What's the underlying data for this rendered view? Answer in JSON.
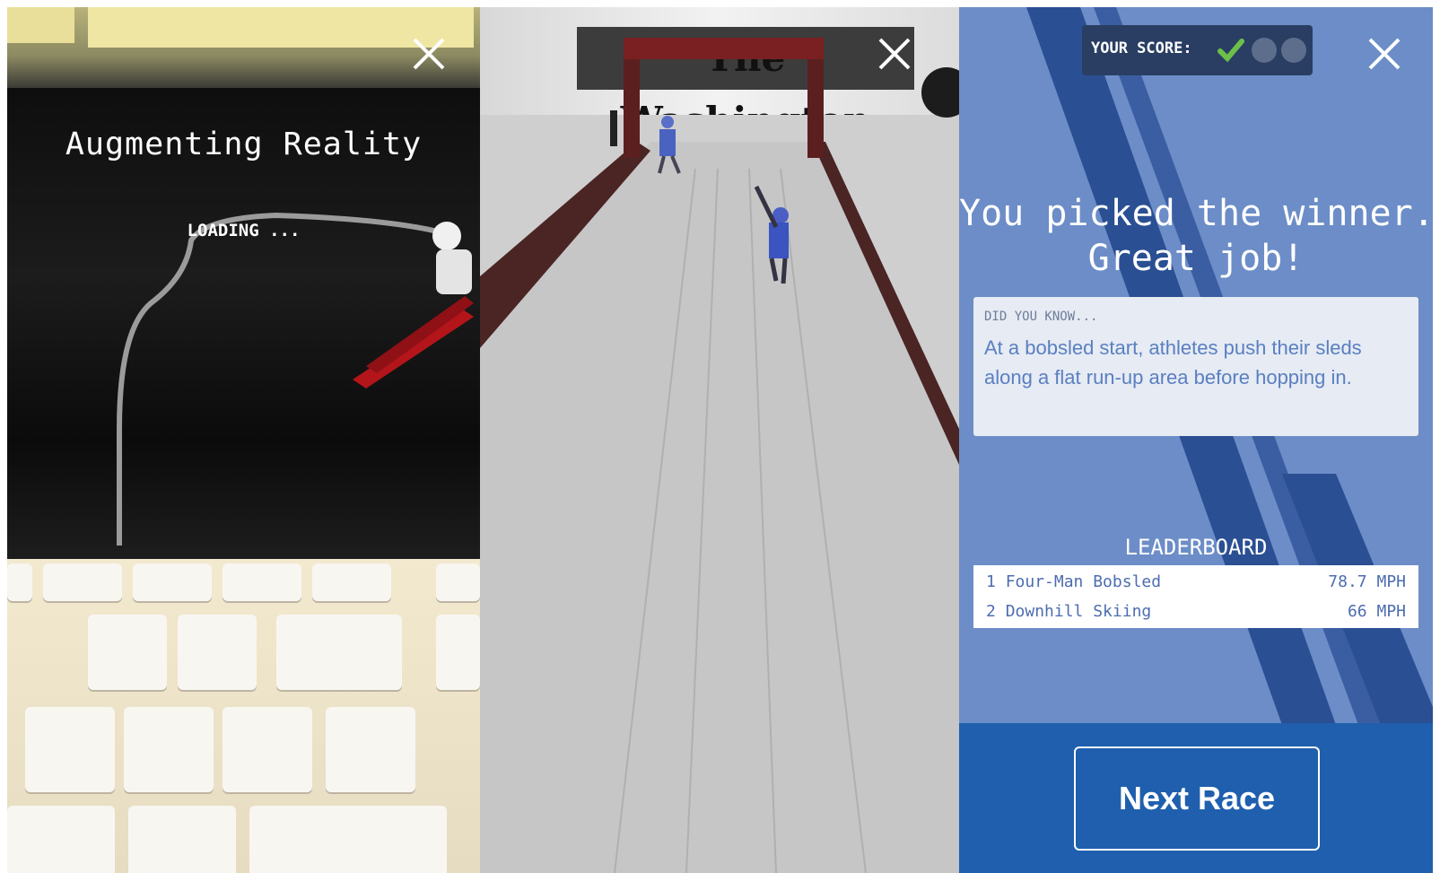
{
  "panel_left": {
    "title": "Augmenting Reality",
    "loading_text": "LOADING ...",
    "close_icon": "close-icon"
  },
  "panel_middle": {
    "sign_text": "The Washington Post",
    "close_icon": "close-icon"
  },
  "panel_right": {
    "score_label": "YOUR SCORE:",
    "score_marks": [
      "check",
      "empty",
      "empty"
    ],
    "headline_line1": "You picked the winner.",
    "headline_line2": "Great job!",
    "did_you_know": {
      "label": "DID YOU KNOW...",
      "text": "At a bobsled start, athletes push their sleds along a flat run-up area before hopping in."
    },
    "leaderboard": {
      "title": "LEADERBOARD",
      "rows": [
        {
          "rank": "1",
          "event": "Four-Man Bobsled",
          "speed": "78.7 MPH"
        },
        {
          "rank": "2",
          "event": "Downhill Skiing",
          "speed": "66 MPH"
        }
      ]
    },
    "next_button_label": "Next Race",
    "colors": {
      "panel_bg": "#6c8dc7",
      "bottom_bar": "#1f5fae",
      "check": "#6cc04a"
    }
  }
}
